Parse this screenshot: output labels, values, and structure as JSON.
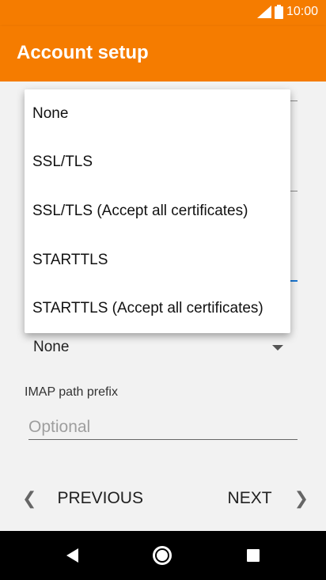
{
  "status_bar": {
    "time": "10:00"
  },
  "app_bar": {
    "title": "Account setup"
  },
  "dropdown": {
    "options": [
      "None",
      "SSL/TLS",
      "SSL/TLS (Accept all certificates)",
      "STARTTLS",
      "STARTTLS (Accept all certificates)"
    ]
  },
  "security": {
    "selected": "None"
  },
  "path_prefix": {
    "label": "IMAP path prefix",
    "placeholder": "Optional",
    "value": ""
  },
  "nav": {
    "previous_label": "PREVIOUS",
    "next_label": "NEXT"
  },
  "colors": {
    "accent": "#f57c00",
    "focus": "#1976d2"
  }
}
